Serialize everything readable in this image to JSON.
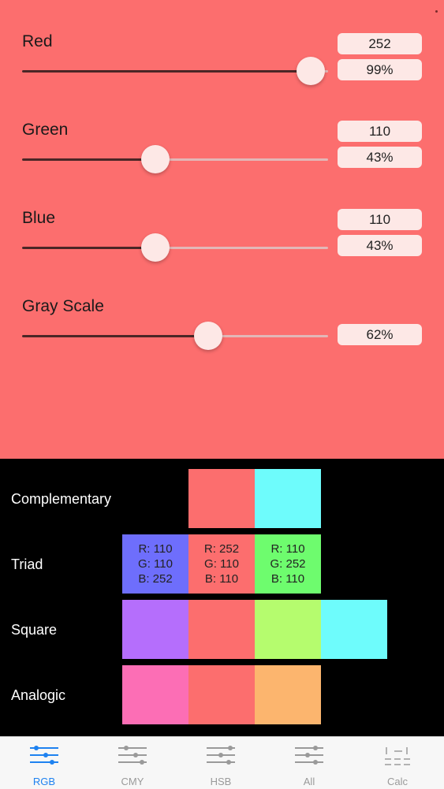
{
  "sliders": [
    {
      "label": "Red",
      "value": "252",
      "percent": "99%",
      "level": 0.99
    },
    {
      "label": "Green",
      "value": "110",
      "percent": "43%",
      "level": 0.43
    },
    {
      "label": "Blue",
      "value": "110",
      "percent": "43%",
      "level": 0.43
    },
    {
      "label": "Gray Scale",
      "percent": "62%",
      "level": 0.62
    }
  ],
  "harmonies": {
    "complementary": {
      "label": "Complementary",
      "colors": [
        "#fc6e6e",
        "#6efcfc"
      ]
    },
    "triad": {
      "label": "Triad",
      "colors": [
        "#6e6efc",
        "#fc6e6e",
        "#6efc6e"
      ],
      "swatches": [
        {
          "r": "R: 110",
          "g": "G: 110",
          "b": "B: 252"
        },
        {
          "r": "R: 252",
          "g": "G: 110",
          "b": "B: 110"
        },
        {
          "r": "R: 110",
          "g": "G: 252",
          "b": "B: 110"
        }
      ]
    },
    "square": {
      "label": "Square",
      "colors": [
        "#b56efc",
        "#fc6e6e",
        "#b5fc6e",
        "#6efcfc"
      ]
    },
    "analogic": {
      "label": "Analogic",
      "colors": [
        "#fc6eb5",
        "#fc6e6e",
        "#fcb56e"
      ]
    }
  },
  "tabs": [
    {
      "label": "RGB",
      "icon": "sliders-icon",
      "active": true
    },
    {
      "label": "CMY",
      "icon": "sliders-icon",
      "active": false
    },
    {
      "label": "HSB",
      "icon": "sliders-icon",
      "active": false
    },
    {
      "label": "All",
      "icon": "sliders-icon",
      "active": false
    },
    {
      "label": "Calc",
      "icon": "calc-icon",
      "active": false
    }
  ],
  "colors": {
    "background": "#fc6e6e",
    "accent": "#1e82f0"
  }
}
